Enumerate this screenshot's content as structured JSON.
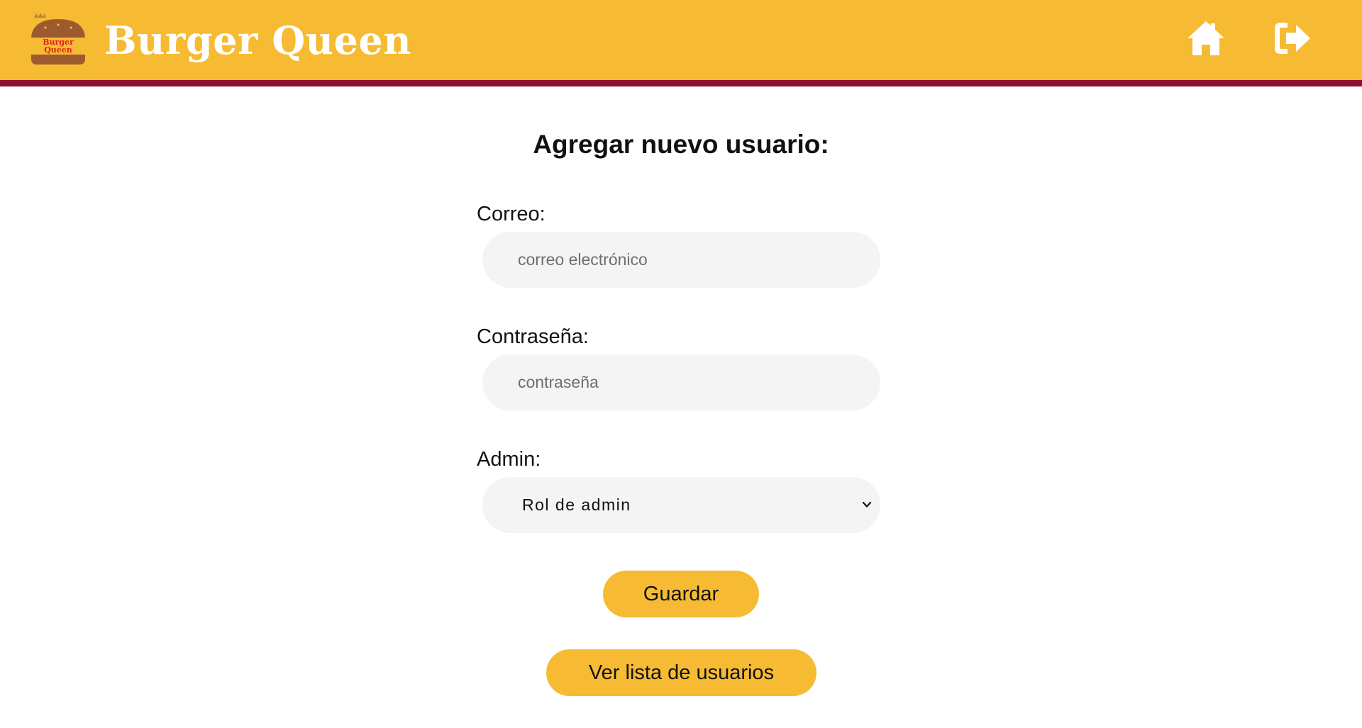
{
  "header": {
    "brand": "Burger Queen",
    "logo_text_line1": "Burger",
    "logo_text_line2": "Queen",
    "home_icon": "home-icon",
    "logout_icon": "sign-out-icon",
    "colors": {
      "bar": "#F6BB33",
      "border": "#8E1132"
    }
  },
  "form": {
    "title": "Agregar nuevo usuario:",
    "email": {
      "label": "Correo:",
      "placeholder": "correo electrónico",
      "value": ""
    },
    "password": {
      "label": "Contraseña:",
      "placeholder": "contraseña",
      "value": ""
    },
    "admin": {
      "label": "Admin:",
      "selected": "Rol de admin",
      "icon": "chevron-down-icon"
    },
    "save_label": "Guardar",
    "list_label": "Ver lista de usuarios"
  }
}
